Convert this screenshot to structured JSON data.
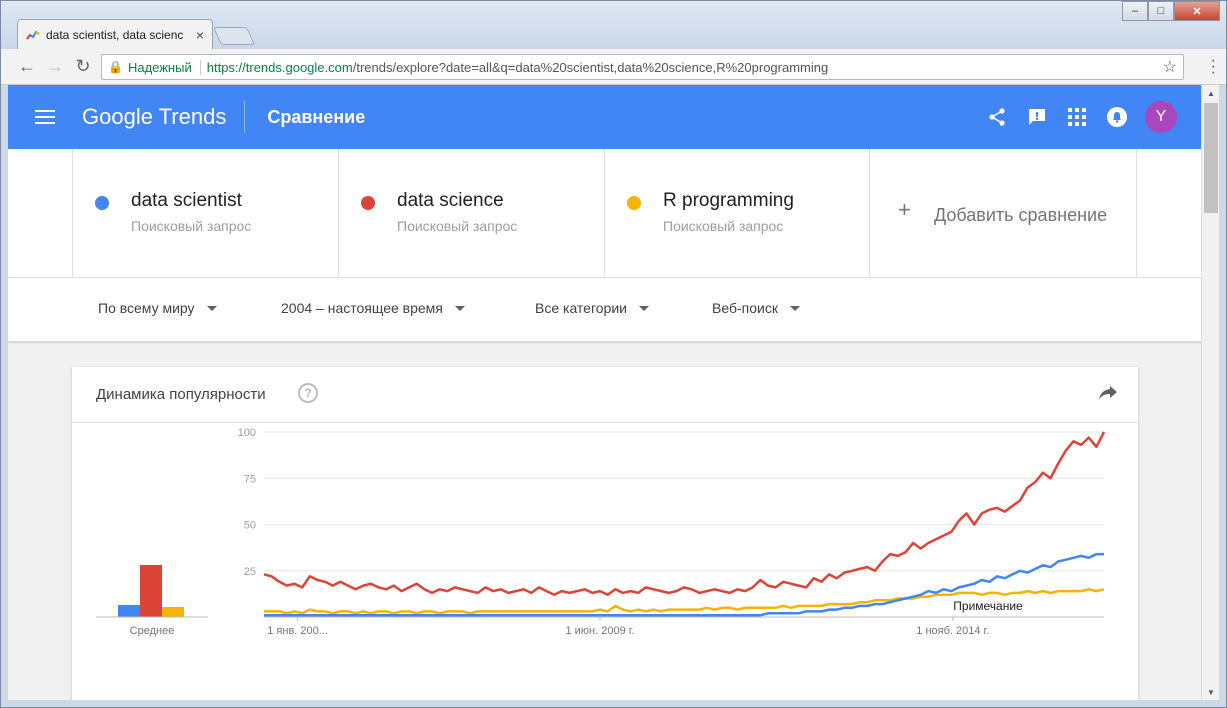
{
  "browser": {
    "tab_title": "data scientist, data scienc",
    "tab_close": "×",
    "secure_label": "Надежный",
    "url_host": "https://trends.google.com",
    "url_path": "/trends/explore?date=all&q=data%20scientist,data%20science,R%20programming",
    "win_min": "–",
    "win_max": "□",
    "win_close": "✕"
  },
  "header": {
    "logo_google": "Google",
    "logo_trends": " Trends",
    "title": "Сравнение",
    "avatar_letter": "Y"
  },
  "terms": [
    {
      "name": "data scientist",
      "sub": "Поисковый запрос",
      "color": "#4285f4"
    },
    {
      "name": "data science",
      "sub": "Поисковый запрос",
      "color": "#db4437"
    },
    {
      "name": "R programming",
      "sub": "Поисковый запрос",
      "color": "#f4b400"
    }
  ],
  "add_compare": {
    "plus": "+",
    "label": "Добавить сравнение"
  },
  "filters": {
    "region": "По всему миру",
    "period": "2004 – настоящее время",
    "category": "Все категории",
    "search_type": "Веб-поиск"
  },
  "card": {
    "title": "Динамика популярности",
    "help": "?"
  },
  "chart_data": {
    "type": "line",
    "y_ticks": [
      "100",
      "75",
      "50",
      "25"
    ],
    "ylim": [
      0,
      100
    ],
    "x_tick_labels": [
      "1 янв. 200...",
      "1 июн. 2009 г.",
      "1 нояб. 2014 г."
    ],
    "note_label": "Примечание",
    "average_label": "Среднее",
    "averages": [
      {
        "name": "data scientist",
        "value": 6,
        "color": "#4285f4"
      },
      {
        "name": "data science",
        "value": 26,
        "color": "#db4437"
      },
      {
        "name": "R programming",
        "value": 5,
        "color": "#f4b400"
      }
    ],
    "x_start": "2004-01",
    "x_end": "2017-03",
    "series": [
      {
        "name": "data science",
        "color": "#db4437",
        "values": [
          23,
          22,
          19,
          17,
          18,
          16,
          22,
          20,
          19,
          17,
          19,
          17,
          15,
          17,
          18,
          16,
          15,
          17,
          14,
          16,
          18,
          15,
          13,
          15,
          14,
          16,
          15,
          14,
          13,
          16,
          14,
          15,
          13,
          14,
          15,
          13,
          16,
          14,
          12,
          14,
          13,
          14,
          15,
          13,
          14,
          12,
          15,
          13,
          14,
          13,
          16,
          15,
          14,
          13,
          14,
          16,
          15,
          13,
          14,
          15,
          14,
          13,
          15,
          14,
          16,
          20,
          17,
          16,
          19,
          18,
          17,
          16,
          21,
          19,
          23,
          21,
          24,
          25,
          26,
          27,
          25,
          30,
          34,
          33,
          35,
          40,
          37,
          40,
          42,
          44,
          46,
          52,
          56,
          50,
          56,
          58,
          59,
          57,
          60,
          63,
          70,
          73,
          78,
          75,
          83,
          90,
          95,
          93,
          97,
          92,
          100
        ]
      },
      {
        "name": "data scientist",
        "color": "#4285f4",
        "values": [
          1,
          1,
          1,
          1,
          1,
          1,
          1,
          1,
          1,
          1,
          1,
          1,
          1,
          1,
          1,
          1,
          1,
          1,
          1,
          1,
          1,
          1,
          1,
          1,
          1,
          1,
          1,
          1,
          1,
          1,
          1,
          1,
          1,
          1,
          1,
          1,
          1,
          1,
          1,
          1,
          1,
          1,
          1,
          1,
          1,
          1,
          1,
          1,
          1,
          1,
          1,
          1,
          1,
          1,
          1,
          1,
          1,
          1,
          1,
          1,
          1,
          1,
          1,
          1,
          1,
          1,
          2,
          2,
          2,
          2,
          2,
          3,
          3,
          3,
          4,
          4,
          5,
          5,
          6,
          6,
          7,
          7,
          8,
          9,
          10,
          11,
          12,
          14,
          13,
          15,
          14,
          16,
          17,
          18,
          20,
          19,
          22,
          21,
          23,
          25,
          24,
          26,
          28,
          27,
          30,
          31,
          32,
          33,
          32,
          34,
          34
        ]
      },
      {
        "name": "R programming",
        "color": "#f4b400",
        "values": [
          3,
          3,
          3,
          2,
          3,
          2,
          4,
          3,
          3,
          2,
          3,
          3,
          2,
          3,
          2,
          3,
          3,
          2,
          3,
          3,
          2,
          3,
          3,
          2,
          3,
          3,
          3,
          2,
          3,
          3,
          3,
          3,
          3,
          3,
          3,
          3,
          3,
          3,
          3,
          3,
          3,
          3,
          3,
          3,
          4,
          3,
          6,
          4,
          3,
          4,
          3,
          4,
          3,
          4,
          4,
          4,
          4,
          4,
          5,
          4,
          5,
          5,
          4,
          5,
          5,
          5,
          5,
          5,
          6,
          5,
          6,
          6,
          6,
          6,
          7,
          7,
          7,
          7,
          8,
          8,
          9,
          9,
          9,
          10,
          10,
          10,
          11,
          11,
          12,
          12,
          12,
          13,
          13,
          13,
          12,
          13,
          13,
          12,
          13,
          13,
          14,
          13,
          14,
          13,
          14,
          14,
          14,
          14,
          15,
          14,
          15
        ]
      }
    ]
  }
}
